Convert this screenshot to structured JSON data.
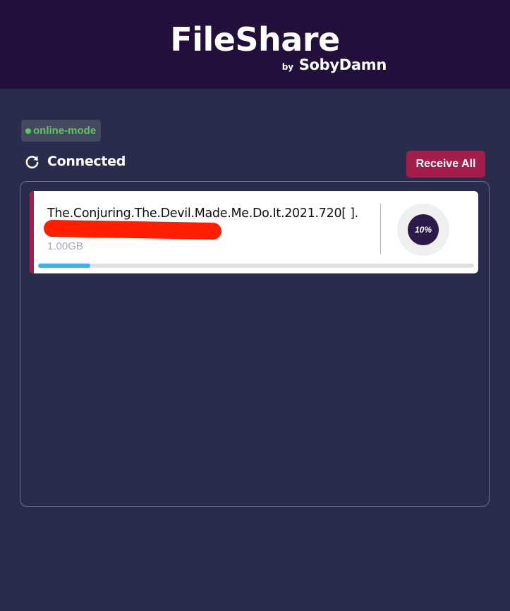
{
  "header": {
    "title": "FileShare",
    "by": "by",
    "author": "SobyDamn"
  },
  "mode": {
    "label": "online-mode",
    "color": "#5cc65c"
  },
  "status": {
    "text": "Connected",
    "icon": "refresh-icon"
  },
  "actions": {
    "receive_all_label": "Receive All"
  },
  "colors": {
    "header_bg": "#220f3b",
    "page_bg": "#2a2c4d",
    "accent": "#a41e4c",
    "progress": "#3bb2ea"
  },
  "files": [
    {
      "name": "The.Conjuring.The.Devil.Made.Me.Do.It.2021.720[                              ].mp4",
      "size": "1.00GB",
      "progress_label": "10%",
      "progress": 0.1
    }
  ]
}
